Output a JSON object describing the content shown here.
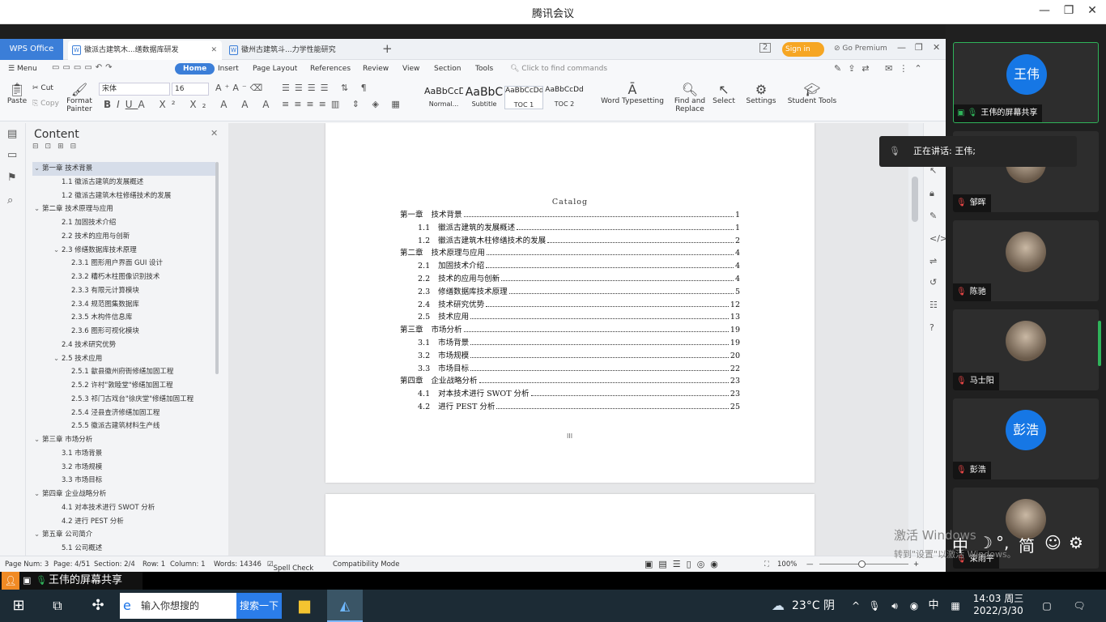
{
  "app": {
    "title": "腾讯会议"
  },
  "tabs": {
    "wps": "WPS Office",
    "doc1": "徽派古建筑木...缮数据库研发",
    "doc2": "徽州古建筑斗...力学性能研究",
    "sign_in": "Sign in",
    "go_premium": "Go Premium"
  },
  "menu": [
    "Menu",
    "Home",
    "Insert",
    "Page Layout",
    "References",
    "Review",
    "View",
    "Section",
    "Tools"
  ],
  "search": {
    "placeholder": "Click to find commands"
  },
  "ribbon": {
    "paste": "Paste",
    "cut": "Cut",
    "copy": "Copy",
    "format_painter": "Format Painter",
    "font": "宋体",
    "size": "16",
    "styles": [
      {
        "preview": "AaBbCcDı",
        "name": "Normal..."
      },
      {
        "preview": "AaBbC",
        "name": "Subtitle"
      },
      {
        "preview": "AaBbCcDd",
        "name": "TOC 1"
      },
      {
        "preview": "AaBbCcDd",
        "name": "TOC 2"
      }
    ],
    "word_typesetting": "Word Typesetting",
    "find_replace": "Find and Replace",
    "select": "Select",
    "settings": "Settings",
    "student_tools": "Student Tools"
  },
  "nav": {
    "title": "Content",
    "items": [
      {
        "level": 1,
        "text": "第一章   技术背景",
        "expand": "v",
        "selected": true
      },
      {
        "level": 2,
        "text": "1.1  徽派古建筑的发展概述",
        "expand": ""
      },
      {
        "level": 2,
        "text": "1.2  徽派古建筑木柱修缮技术的发展",
        "expand": ""
      },
      {
        "level": 1,
        "text": "第二章   技术原理与应用",
        "expand": "v"
      },
      {
        "level": 2,
        "text": "2.1   加固技术介绍",
        "expand": ""
      },
      {
        "level": 2,
        "text": "2.2   技术的应用与创新",
        "expand": ""
      },
      {
        "level": 2,
        "text": "2.3  修缮数据库技术原理",
        "expand": "v"
      },
      {
        "level": 3,
        "text": "2.3.1  图形用户界面 GUI 设计",
        "expand": ""
      },
      {
        "level": 3,
        "text": "2.3.2  糟朽木柱图像识别技术",
        "expand": ""
      },
      {
        "level": 3,
        "text": "2.3.3  有限元计算模块",
        "expand": ""
      },
      {
        "level": 3,
        "text": "2.3.4  规范图集数据库",
        "expand": ""
      },
      {
        "level": 3,
        "text": "2.3.5  木构件信息库",
        "expand": ""
      },
      {
        "level": 3,
        "text": "2.3.6  图形可视化模块",
        "expand": ""
      },
      {
        "level": 2,
        "text": "2.4  技术研究优势",
        "expand": ""
      },
      {
        "level": 2,
        "text": "2.5  技术应用",
        "expand": "v"
      },
      {
        "level": 3,
        "text": "2.5.1  歙县徽州府衙修缮加固工程",
        "expand": ""
      },
      {
        "level": 3,
        "text": "2.5.2  许村\"敦睦堂\"修缮加固工程",
        "expand": ""
      },
      {
        "level": 3,
        "text": "2.5.3  祁门古戏台\"徐庆堂\"修缮加固工程",
        "expand": ""
      },
      {
        "level": 3,
        "text": "2.5.4  泾县查济修缮加固工程",
        "expand": ""
      },
      {
        "level": 3,
        "text": "2.5.5  徽派古建筑材料生产线",
        "expand": ""
      },
      {
        "level": 1,
        "text": "第三章   市场分析",
        "expand": "v"
      },
      {
        "level": 2,
        "text": "3.1  市场背景",
        "expand": ""
      },
      {
        "level": 2,
        "text": "3.2  市场规模",
        "expand": ""
      },
      {
        "level": 2,
        "text": "3.3  市场目标",
        "expand": ""
      },
      {
        "level": 1,
        "text": "第四章   企业战略分析",
        "expand": "v"
      },
      {
        "level": 2,
        "text": "4.1   对本技术进行 SWOT 分析",
        "expand": ""
      },
      {
        "level": 2,
        "text": "4.2   进行 PEST 分析",
        "expand": ""
      },
      {
        "level": 1,
        "text": "第五章   公司简介",
        "expand": "v"
      },
      {
        "level": 2,
        "text": "5.1  公司概述",
        "expand": ""
      }
    ]
  },
  "document": {
    "catalog_title": "Catalog",
    "entries": [
      {
        "level": 1,
        "num": "第一章",
        "title": "技术背景",
        "page": "1"
      },
      {
        "level": 2,
        "num": "1.1",
        "title": "徽派古建筑的发展概述",
        "page": "1"
      },
      {
        "level": 2,
        "num": "1.2",
        "title": "徽派古建筑木柱修缮技术的发展",
        "page": "2"
      },
      {
        "level": 1,
        "num": "第二章",
        "title": "技术原理与应用",
        "page": "4"
      },
      {
        "level": 2,
        "num": "2.1",
        "title": "加固技术介绍",
        "page": "4"
      },
      {
        "level": 2,
        "num": "2.2",
        "title": "技术的应用与创新",
        "page": "4"
      },
      {
        "level": 2,
        "num": "2.3",
        "title": "修缮数据库技术原理",
        "page": "5"
      },
      {
        "level": 2,
        "num": "2.4",
        "title": "技术研究优势",
        "page": "12"
      },
      {
        "level": 2,
        "num": "2.5",
        "title": "技术应用",
        "page": "13"
      },
      {
        "level": 1,
        "num": "第三章",
        "title": "市场分析",
        "page": "19"
      },
      {
        "level": 2,
        "num": "3.1",
        "title": "市场背景",
        "page": "19"
      },
      {
        "level": 2,
        "num": "3.2",
        "title": "市场规模",
        "page": "20"
      },
      {
        "level": 2,
        "num": "3.3",
        "title": "市场目标",
        "page": "22"
      },
      {
        "level": 1,
        "num": "第四章",
        "title": "企业战略分析",
        "page": "23"
      },
      {
        "level": 2,
        "num": "4.1",
        "title": "对本技术进行 SWOT 分析",
        "page": "23"
      },
      {
        "level": 2,
        "num": "4.2",
        "title": "进行 PEST 分析",
        "page": "25"
      }
    ]
  },
  "status": {
    "page_num": "Page Num: 3",
    "page": "Page: 4/51",
    "section": "Section: 2/4",
    "row": "Row: 1",
    "column": "Column: 1",
    "words": "Words: 14346",
    "spell_check": "Spell Check",
    "compat": "Compatibility Mode",
    "zoom": "100%"
  },
  "meeting": {
    "speaking": "正在讲话: 王伟;",
    "participants": [
      {
        "name": "王伟的屏幕共享",
        "avatar_text": "王伟",
        "avatar_color": "#1677e5"
      },
      {
        "name": "邹晖",
        "avatar_text": ""
      },
      {
        "name": "陈驰",
        "avatar_text": ""
      },
      {
        "name": "马士阳",
        "avatar_text": ""
      },
      {
        "name": "彭浩",
        "avatar_text": "彭浩",
        "avatar_color": "#1677e5"
      },
      {
        "name": "束雨平",
        "avatar_text": ""
      }
    ],
    "share_label": "王伟的屏幕共享",
    "ime": [
      "中",
      "简"
    ],
    "activate": "激活 Windows",
    "activate2": "转到\"设置\"以激活 Windows。"
  },
  "taskbar": {
    "search_placeholder": "输入你想搜的",
    "search_button": "搜索一下",
    "weather": "23°C 阴",
    "ime": "中",
    "time": "14:03 周三",
    "date": "2022/3/30"
  }
}
